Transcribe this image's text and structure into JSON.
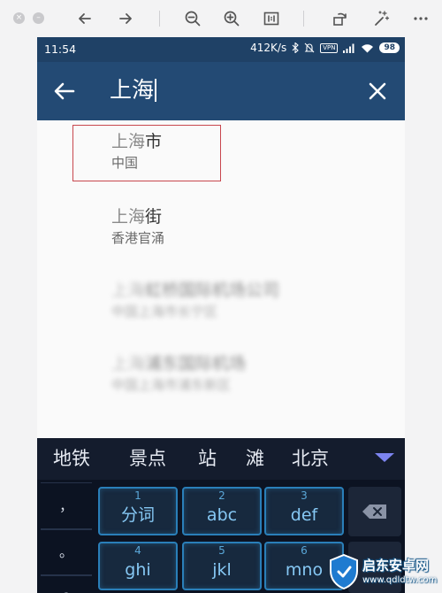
{
  "status_bar": {
    "time": "11:54",
    "net_speed": "412K/s",
    "vpn": "VPN",
    "battery": "98"
  },
  "search": {
    "query": "上海"
  },
  "results": [
    {
      "name_prefix": "上海",
      "name_rest": "市",
      "sub": "中国",
      "blurred": false
    },
    {
      "name_prefix": "上海",
      "name_rest": "街",
      "sub": "香港官涌",
      "blurred": false
    },
    {
      "name_prefix": "上海",
      "name_rest": "虹桥国际机场公司",
      "sub": "中国上海市长宁区",
      "blurred": true
    },
    {
      "name_prefix": "上海",
      "name_rest": "浦东国际机场",
      "sub": "中国上海市浦东新区",
      "blurred": true
    }
  ],
  "keyboard": {
    "candidates": [
      "地铁",
      "景点",
      "站",
      "滩",
      "北京"
    ],
    "punctuation": [
      "，",
      "。",
      "?"
    ],
    "keys": [
      {
        "num": "1",
        "label": "分词"
      },
      {
        "num": "2",
        "label": "abc"
      },
      {
        "num": "3",
        "label": "def"
      },
      {
        "num": "4",
        "label": "ghi"
      },
      {
        "num": "5",
        "label": "jkl"
      },
      {
        "num": "6",
        "label": "mno"
      }
    ]
  },
  "watermark": {
    "title": "启东安卓网",
    "url": "www.qdldtw.com"
  },
  "colors": {
    "status_bar": "#1f4166",
    "app_bar": "#234a74",
    "highlight_box": "#c8474e",
    "key_border": "#2a7fb9",
    "key_text": "#86c8f4",
    "candidate_expand": "#7c84f0"
  },
  "icons": {
    "toolbar": [
      "close-window-icon",
      "minimize-window-icon",
      "back-arrow-icon",
      "forward-arrow-icon",
      "zoom-out-icon",
      "zoom-in-icon",
      "actual-size-icon",
      "rotate-icon",
      "magic-wand-icon",
      "more-icon"
    ],
    "app": [
      "back-arrow-icon",
      "clear-icon",
      "backspace-icon",
      "expand-candidates-icon"
    ]
  }
}
